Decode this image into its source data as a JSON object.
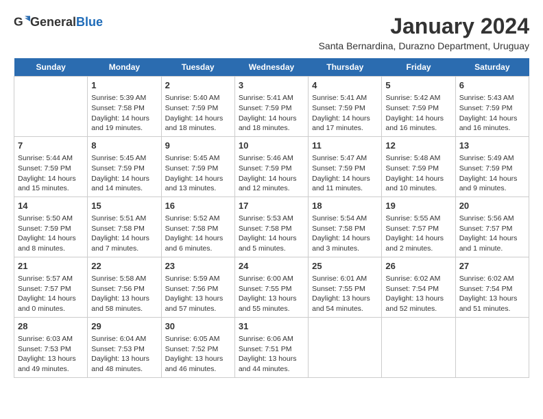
{
  "header": {
    "logo_general": "General",
    "logo_blue": "Blue",
    "title": "January 2024",
    "subtitle": "Santa Bernardina, Durazno Department, Uruguay"
  },
  "days_of_week": [
    "Sunday",
    "Monday",
    "Tuesday",
    "Wednesday",
    "Thursday",
    "Friday",
    "Saturday"
  ],
  "weeks": [
    [
      {
        "date": "",
        "info": ""
      },
      {
        "date": "1",
        "info": "Sunrise: 5:39 AM\nSunset: 7:58 PM\nDaylight: 14 hours\nand 19 minutes."
      },
      {
        "date": "2",
        "info": "Sunrise: 5:40 AM\nSunset: 7:59 PM\nDaylight: 14 hours\nand 18 minutes."
      },
      {
        "date": "3",
        "info": "Sunrise: 5:41 AM\nSunset: 7:59 PM\nDaylight: 14 hours\nand 18 minutes."
      },
      {
        "date": "4",
        "info": "Sunrise: 5:41 AM\nSunset: 7:59 PM\nDaylight: 14 hours\nand 17 minutes."
      },
      {
        "date": "5",
        "info": "Sunrise: 5:42 AM\nSunset: 7:59 PM\nDaylight: 14 hours\nand 16 minutes."
      },
      {
        "date": "6",
        "info": "Sunrise: 5:43 AM\nSunset: 7:59 PM\nDaylight: 14 hours\nand 16 minutes."
      }
    ],
    [
      {
        "date": "7",
        "info": "Sunrise: 5:44 AM\nSunset: 7:59 PM\nDaylight: 14 hours\nand 15 minutes."
      },
      {
        "date": "8",
        "info": "Sunrise: 5:45 AM\nSunset: 7:59 PM\nDaylight: 14 hours\nand 14 minutes."
      },
      {
        "date": "9",
        "info": "Sunrise: 5:45 AM\nSunset: 7:59 PM\nDaylight: 14 hours\nand 13 minutes."
      },
      {
        "date": "10",
        "info": "Sunrise: 5:46 AM\nSunset: 7:59 PM\nDaylight: 14 hours\nand 12 minutes."
      },
      {
        "date": "11",
        "info": "Sunrise: 5:47 AM\nSunset: 7:59 PM\nDaylight: 14 hours\nand 11 minutes."
      },
      {
        "date": "12",
        "info": "Sunrise: 5:48 AM\nSunset: 7:59 PM\nDaylight: 14 hours\nand 10 minutes."
      },
      {
        "date": "13",
        "info": "Sunrise: 5:49 AM\nSunset: 7:59 PM\nDaylight: 14 hours\nand 9 minutes."
      }
    ],
    [
      {
        "date": "14",
        "info": "Sunrise: 5:50 AM\nSunset: 7:59 PM\nDaylight: 14 hours\nand 8 minutes."
      },
      {
        "date": "15",
        "info": "Sunrise: 5:51 AM\nSunset: 7:58 PM\nDaylight: 14 hours\nand 7 minutes."
      },
      {
        "date": "16",
        "info": "Sunrise: 5:52 AM\nSunset: 7:58 PM\nDaylight: 14 hours\nand 6 minutes."
      },
      {
        "date": "17",
        "info": "Sunrise: 5:53 AM\nSunset: 7:58 PM\nDaylight: 14 hours\nand 5 minutes."
      },
      {
        "date": "18",
        "info": "Sunrise: 5:54 AM\nSunset: 7:58 PM\nDaylight: 14 hours\nand 3 minutes."
      },
      {
        "date": "19",
        "info": "Sunrise: 5:55 AM\nSunset: 7:57 PM\nDaylight: 14 hours\nand 2 minutes."
      },
      {
        "date": "20",
        "info": "Sunrise: 5:56 AM\nSunset: 7:57 PM\nDaylight: 14 hours\nand 1 minute."
      }
    ],
    [
      {
        "date": "21",
        "info": "Sunrise: 5:57 AM\nSunset: 7:57 PM\nDaylight: 14 hours\nand 0 minutes."
      },
      {
        "date": "22",
        "info": "Sunrise: 5:58 AM\nSunset: 7:56 PM\nDaylight: 13 hours\nand 58 minutes."
      },
      {
        "date": "23",
        "info": "Sunrise: 5:59 AM\nSunset: 7:56 PM\nDaylight: 13 hours\nand 57 minutes."
      },
      {
        "date": "24",
        "info": "Sunrise: 6:00 AM\nSunset: 7:55 PM\nDaylight: 13 hours\nand 55 minutes."
      },
      {
        "date": "25",
        "info": "Sunrise: 6:01 AM\nSunset: 7:55 PM\nDaylight: 13 hours\nand 54 minutes."
      },
      {
        "date": "26",
        "info": "Sunrise: 6:02 AM\nSunset: 7:54 PM\nDaylight: 13 hours\nand 52 minutes."
      },
      {
        "date": "27",
        "info": "Sunrise: 6:02 AM\nSunset: 7:54 PM\nDaylight: 13 hours\nand 51 minutes."
      }
    ],
    [
      {
        "date": "28",
        "info": "Sunrise: 6:03 AM\nSunset: 7:53 PM\nDaylight: 13 hours\nand 49 minutes."
      },
      {
        "date": "29",
        "info": "Sunrise: 6:04 AM\nSunset: 7:53 PM\nDaylight: 13 hours\nand 48 minutes."
      },
      {
        "date": "30",
        "info": "Sunrise: 6:05 AM\nSunset: 7:52 PM\nDaylight: 13 hours\nand 46 minutes."
      },
      {
        "date": "31",
        "info": "Sunrise: 6:06 AM\nSunset: 7:51 PM\nDaylight: 13 hours\nand 44 minutes."
      },
      {
        "date": "",
        "info": ""
      },
      {
        "date": "",
        "info": ""
      },
      {
        "date": "",
        "info": ""
      }
    ]
  ]
}
